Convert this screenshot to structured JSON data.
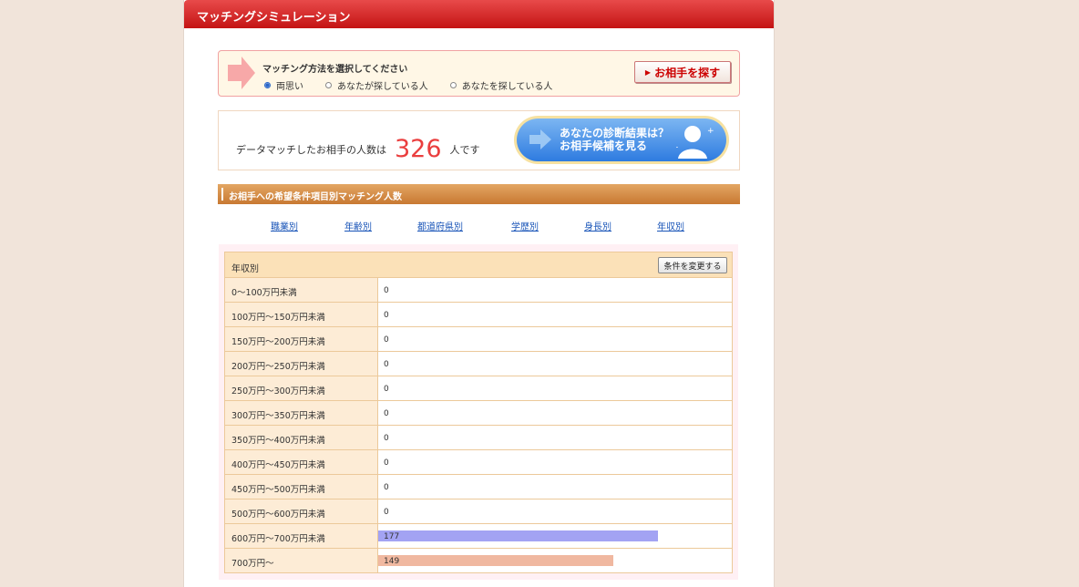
{
  "title": "マッチングシミュレーション",
  "method": {
    "prompt": "マッチング方法を選択してください",
    "options": [
      "両思い",
      "あなたが探している人",
      "あなたを探している人"
    ],
    "selected_index": 0,
    "search_button": "お相手を探す"
  },
  "count": {
    "prefix": "データマッチしたお相手の人数は",
    "number": "326",
    "suffix": "人です",
    "diag_line1": "あなたの診断結果は？",
    "diag_line2": "お相手候補を見る"
  },
  "section_title": "お相手への希望条件項目別マッチング人数",
  "tabs": [
    "職業別",
    "年齢別",
    "都道府県別",
    "学歴別",
    "身長別",
    "年収別"
  ],
  "table": {
    "heading": "年収別",
    "change_button": "条件を変更する",
    "rows": [
      {
        "label": "0〜100万円未満",
        "value": "0"
      },
      {
        "label": "100万円〜150万円未満",
        "value": "0"
      },
      {
        "label": "150万円〜200万円未満",
        "value": "0"
      },
      {
        "label": "200万円〜250万円未満",
        "value": "0"
      },
      {
        "label": "250万円〜300万円未満",
        "value": "0"
      },
      {
        "label": "300万円〜350万円未満",
        "value": "0"
      },
      {
        "label": "350万円〜400万円未満",
        "value": "0"
      },
      {
        "label": "400万円〜450万円未満",
        "value": "0"
      },
      {
        "label": "450万円〜500万円未満",
        "value": "0"
      },
      {
        "label": "500万円〜600万円未満",
        "value": "0"
      },
      {
        "label": "600万円〜700万円未満",
        "value": "177",
        "bar_color": "#a3a3f3"
      },
      {
        "label": "700万円〜",
        "value": "149",
        "bar_color": "#f0b8a0"
      }
    ]
  },
  "colors": {
    "title_red": "#d42020",
    "count_red": "#ea3e3e",
    "link_blue": "#1a55b8",
    "section_orange": "#d68b45"
  }
}
